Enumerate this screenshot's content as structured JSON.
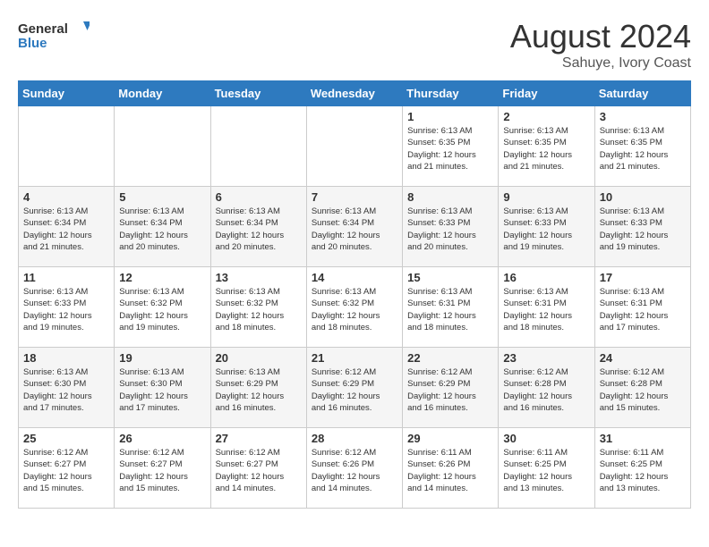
{
  "header": {
    "logo_line1": "General",
    "logo_line2": "Blue",
    "month_year": "August 2024",
    "location": "Sahuye, Ivory Coast"
  },
  "days_of_week": [
    "Sunday",
    "Monday",
    "Tuesday",
    "Wednesday",
    "Thursday",
    "Friday",
    "Saturday"
  ],
  "weeks": [
    [
      {
        "day": "",
        "info": ""
      },
      {
        "day": "",
        "info": ""
      },
      {
        "day": "",
        "info": ""
      },
      {
        "day": "",
        "info": ""
      },
      {
        "day": "1",
        "info": "Sunrise: 6:13 AM\nSunset: 6:35 PM\nDaylight: 12 hours\nand 21 minutes."
      },
      {
        "day": "2",
        "info": "Sunrise: 6:13 AM\nSunset: 6:35 PM\nDaylight: 12 hours\nand 21 minutes."
      },
      {
        "day": "3",
        "info": "Sunrise: 6:13 AM\nSunset: 6:35 PM\nDaylight: 12 hours\nand 21 minutes."
      }
    ],
    [
      {
        "day": "4",
        "info": "Sunrise: 6:13 AM\nSunset: 6:34 PM\nDaylight: 12 hours\nand 21 minutes."
      },
      {
        "day": "5",
        "info": "Sunrise: 6:13 AM\nSunset: 6:34 PM\nDaylight: 12 hours\nand 20 minutes."
      },
      {
        "day": "6",
        "info": "Sunrise: 6:13 AM\nSunset: 6:34 PM\nDaylight: 12 hours\nand 20 minutes."
      },
      {
        "day": "7",
        "info": "Sunrise: 6:13 AM\nSunset: 6:34 PM\nDaylight: 12 hours\nand 20 minutes."
      },
      {
        "day": "8",
        "info": "Sunrise: 6:13 AM\nSunset: 6:33 PM\nDaylight: 12 hours\nand 20 minutes."
      },
      {
        "day": "9",
        "info": "Sunrise: 6:13 AM\nSunset: 6:33 PM\nDaylight: 12 hours\nand 19 minutes."
      },
      {
        "day": "10",
        "info": "Sunrise: 6:13 AM\nSunset: 6:33 PM\nDaylight: 12 hours\nand 19 minutes."
      }
    ],
    [
      {
        "day": "11",
        "info": "Sunrise: 6:13 AM\nSunset: 6:33 PM\nDaylight: 12 hours\nand 19 minutes."
      },
      {
        "day": "12",
        "info": "Sunrise: 6:13 AM\nSunset: 6:32 PM\nDaylight: 12 hours\nand 19 minutes."
      },
      {
        "day": "13",
        "info": "Sunrise: 6:13 AM\nSunset: 6:32 PM\nDaylight: 12 hours\nand 18 minutes."
      },
      {
        "day": "14",
        "info": "Sunrise: 6:13 AM\nSunset: 6:32 PM\nDaylight: 12 hours\nand 18 minutes."
      },
      {
        "day": "15",
        "info": "Sunrise: 6:13 AM\nSunset: 6:31 PM\nDaylight: 12 hours\nand 18 minutes."
      },
      {
        "day": "16",
        "info": "Sunrise: 6:13 AM\nSunset: 6:31 PM\nDaylight: 12 hours\nand 18 minutes."
      },
      {
        "day": "17",
        "info": "Sunrise: 6:13 AM\nSunset: 6:31 PM\nDaylight: 12 hours\nand 17 minutes."
      }
    ],
    [
      {
        "day": "18",
        "info": "Sunrise: 6:13 AM\nSunset: 6:30 PM\nDaylight: 12 hours\nand 17 minutes."
      },
      {
        "day": "19",
        "info": "Sunrise: 6:13 AM\nSunset: 6:30 PM\nDaylight: 12 hours\nand 17 minutes."
      },
      {
        "day": "20",
        "info": "Sunrise: 6:13 AM\nSunset: 6:29 PM\nDaylight: 12 hours\nand 16 minutes."
      },
      {
        "day": "21",
        "info": "Sunrise: 6:12 AM\nSunset: 6:29 PM\nDaylight: 12 hours\nand 16 minutes."
      },
      {
        "day": "22",
        "info": "Sunrise: 6:12 AM\nSunset: 6:29 PM\nDaylight: 12 hours\nand 16 minutes."
      },
      {
        "day": "23",
        "info": "Sunrise: 6:12 AM\nSunset: 6:28 PM\nDaylight: 12 hours\nand 16 minutes."
      },
      {
        "day": "24",
        "info": "Sunrise: 6:12 AM\nSunset: 6:28 PM\nDaylight: 12 hours\nand 15 minutes."
      }
    ],
    [
      {
        "day": "25",
        "info": "Sunrise: 6:12 AM\nSunset: 6:27 PM\nDaylight: 12 hours\nand 15 minutes."
      },
      {
        "day": "26",
        "info": "Sunrise: 6:12 AM\nSunset: 6:27 PM\nDaylight: 12 hours\nand 15 minutes."
      },
      {
        "day": "27",
        "info": "Sunrise: 6:12 AM\nSunset: 6:27 PM\nDaylight: 12 hours\nand 14 minutes."
      },
      {
        "day": "28",
        "info": "Sunrise: 6:12 AM\nSunset: 6:26 PM\nDaylight: 12 hours\nand 14 minutes."
      },
      {
        "day": "29",
        "info": "Sunrise: 6:11 AM\nSunset: 6:26 PM\nDaylight: 12 hours\nand 14 minutes."
      },
      {
        "day": "30",
        "info": "Sunrise: 6:11 AM\nSunset: 6:25 PM\nDaylight: 12 hours\nand 13 minutes."
      },
      {
        "day": "31",
        "info": "Sunrise: 6:11 AM\nSunset: 6:25 PM\nDaylight: 12 hours\nand 13 minutes."
      }
    ]
  ]
}
